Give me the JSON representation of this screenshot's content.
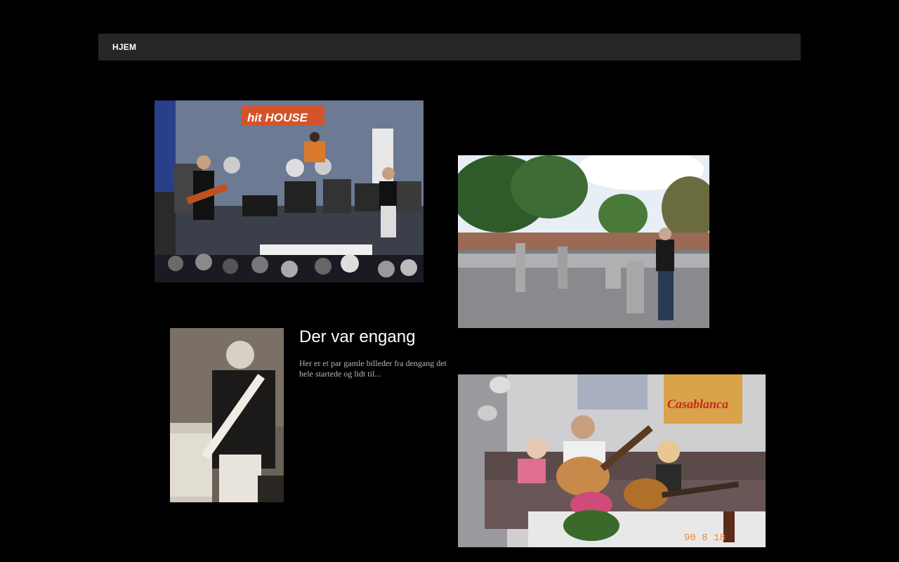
{
  "nav": {
    "items": [
      {
        "label": "HJEM"
      }
    ]
  },
  "article": {
    "title": "Der var engang",
    "body": "Her er et par gamle billeder fra dengang det hele startede og lidt til..."
  },
  "photos": {
    "concert": {
      "sign_text": "hit HOUSE"
    },
    "living_room": {
      "poster_text": "Casablanca",
      "date_stamp": "90 8 18"
    }
  },
  "colors": {
    "background": "#000000",
    "navbar": "#262626",
    "title": "#ffffff",
    "body_text": "#b8b8b8"
  }
}
